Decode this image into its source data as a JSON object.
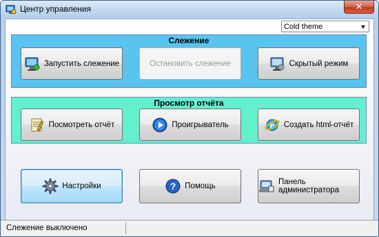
{
  "window": {
    "title": "Центр управления"
  },
  "theme": {
    "selected": "Cold theme"
  },
  "tracking": {
    "title": "Слежение",
    "start_label": "Запустить слежение",
    "stop_label": "Остановить слежение",
    "hidden_label": "Скрытый режим"
  },
  "report": {
    "title": "Просмотр отчёта",
    "view_label": "Посмотреть отчёт",
    "player_label": "Проигрыватель",
    "html_label": "Создать html-отчёт"
  },
  "bottom": {
    "settings_label": "Настройки",
    "help_label": "Помощь",
    "admin_label": "Панель администратора"
  },
  "status": {
    "text": "Слежение выключено"
  }
}
